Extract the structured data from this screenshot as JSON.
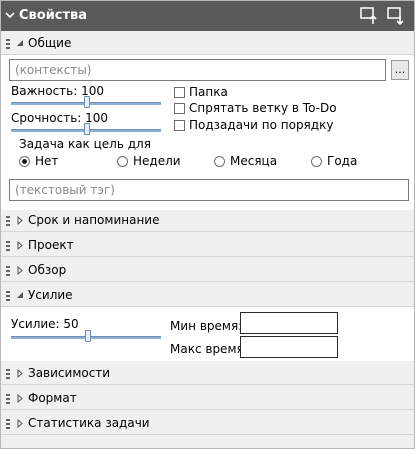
{
  "header": {
    "title": "Свойства"
  },
  "icons": {
    "collapse": "chevron-down-icon",
    "move_up": "move-up-icon",
    "move_down": "move-down-icon",
    "grip": "drag-grip-icon"
  },
  "sections": {
    "general": "Общие",
    "due": "Срок и напоминание",
    "project": "Проект",
    "review": "Обзор",
    "effort": "Усилие",
    "dependencies": "Зависимости",
    "format": "Формат",
    "stats": "Статистика задачи"
  },
  "general": {
    "contexts_placeholder": "(контексты)",
    "browse_label": "...",
    "importance_label": "Важность: 100",
    "importance_value": 100,
    "urgency_label": "Срочность: 100",
    "urgency_value": 100,
    "folder_label": "Папка",
    "hide_label": "Спрятать ветку в To-Do",
    "subtasks_label": "Подзадачи по порядку",
    "goal_label": "Задача как цель для",
    "goal_options": [
      "Нет",
      "Недели",
      "Месяца",
      "Года"
    ],
    "goal_selected": "Нет",
    "tag_placeholder": "(текстовый тэг)"
  },
  "effort": {
    "effort_label": "Усилие: 50",
    "effort_value": 50,
    "min_time_label": "Мин время:",
    "max_time_label": "Макс время:"
  },
  "colors": {
    "titlebar": "#5a5a5a",
    "slider_track": "#8ab0d6"
  }
}
